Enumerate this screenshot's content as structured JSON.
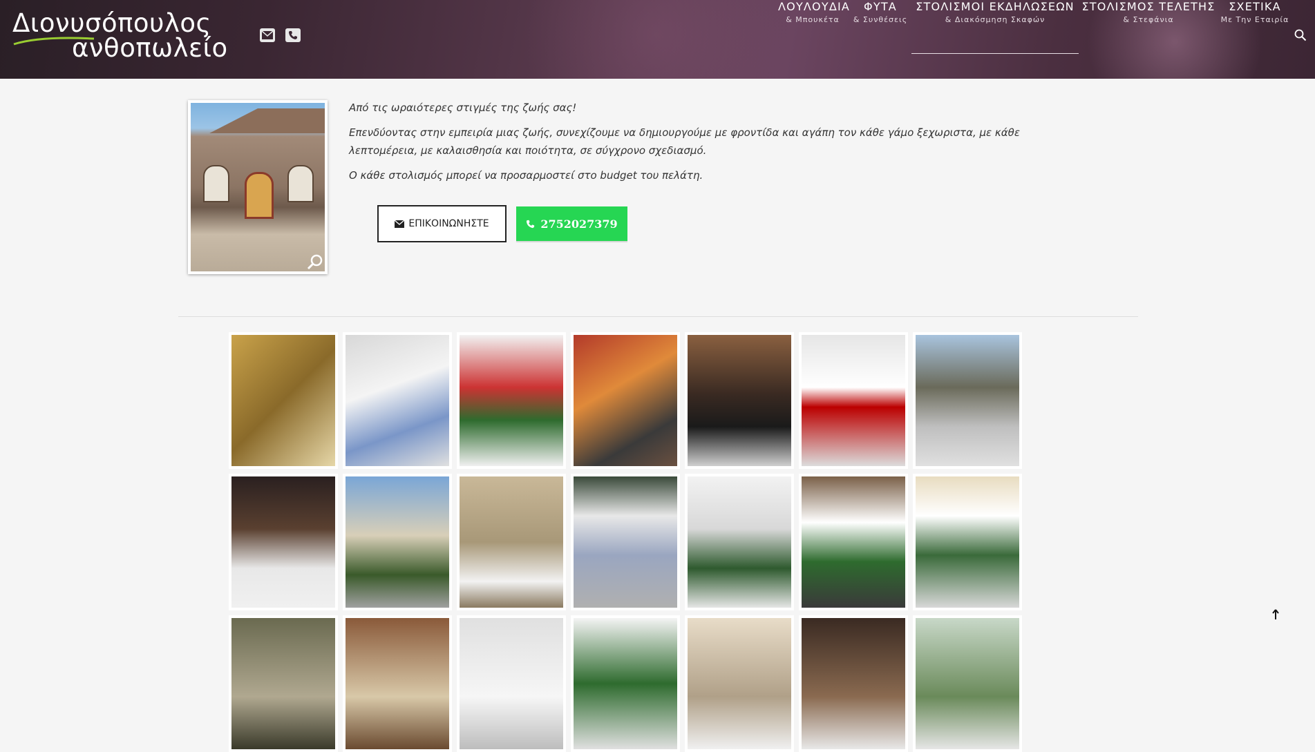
{
  "header": {
    "logo_line1": "Διονυσόπουλος",
    "logo_line2": "ανθοπωλείο",
    "icons": [
      "envelope-icon",
      "phone-icon"
    ],
    "nav": [
      {
        "label": "ΛΟΥΛΟΥΔΙΑ",
        "sub": "& Μπουκέτα"
      },
      {
        "label": "ΦΥΤΑ",
        "sub": "& Συνθέσεις"
      },
      {
        "label": "ΣΤΟΛΙΣΜΟΙ ΕΚΔΗΛΩΣΕΩΝ",
        "sub": "& Διακόσμηση Σκαφών",
        "active": true
      },
      {
        "label": "ΣΤΟΛΙΣΜΟΣ ΤΕΛΕΤΗΣ",
        "sub": "& Στεφάνια"
      },
      {
        "label": "ΣΧΕΤΙΚΑ",
        "sub": "Με Την Εταιρία"
      }
    ]
  },
  "intro": {
    "line1": "Από τις ωραιότερες στιγμές της ζωής σας!",
    "line2": "Επενδύοντας στην εμπειρία μιας ζωής, συνεχίζουμε να δημιουργούμε με φροντίδα και αγάπη τον κάθε γάμο ξεχωριστα, με κάθε λεπτομέρεια, με καλαισθησία και ποιότητα, σε σύγχρονο σχεδιασμό.",
    "line3": "Ο κάθε στολισμός μπορεί να προσαρμοστεί στο budget του πελάτη."
  },
  "buttons": {
    "contact_label": "ΕΠΙΚΟΙΝΩΝΗΣΤΕ",
    "phone_label": "2752027379"
  },
  "colors": {
    "phone_button": "#26d653",
    "header_bg": "#3a2632"
  }
}
